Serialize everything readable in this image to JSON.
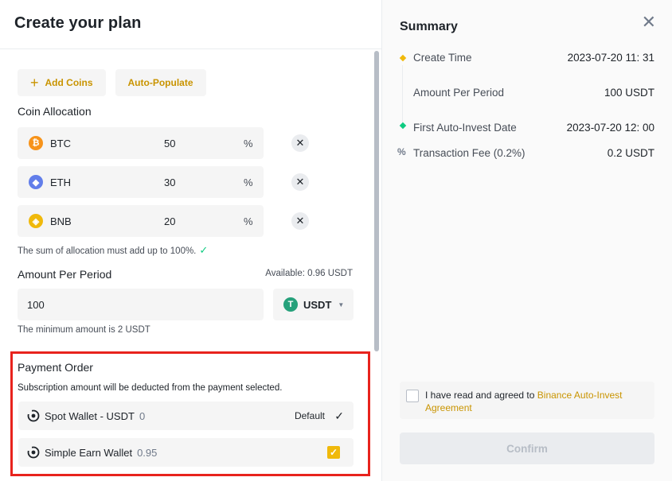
{
  "left": {
    "title": "Create your plan",
    "add_coins_label": "Add Coins",
    "auto_populate_label": "Auto-Populate",
    "coin_allocation_label": "Coin Allocation",
    "coins": [
      {
        "symbol": "BTC",
        "value": "50",
        "unit": "%",
        "icon_color": "#f7931a",
        "icon": "₿"
      },
      {
        "symbol": "ETH",
        "value": "30",
        "unit": "%",
        "icon_color": "#627eea",
        "icon": "◆"
      },
      {
        "symbol": "BNB",
        "value": "20",
        "unit": "%",
        "icon_color": "#f0b90b",
        "icon": "◈"
      }
    ],
    "allocation_hint": "The sum of allocation must add up to 100%.",
    "amount_label": "Amount Per Period",
    "available_text": "Available: 0.96 USDT",
    "amount_value": "100",
    "currency": "USDT",
    "minimum_hint": "The minimum amount is 2 USDT",
    "payment": {
      "title": "Payment Order",
      "subtitle": "Subscription amount will be deducted from the payment selected.",
      "options": [
        {
          "name": "Spot Wallet - USDT",
          "balance": "0",
          "tag": "Default"
        },
        {
          "name": "Simple Earn Wallet",
          "balance": "0.95",
          "tag": ""
        }
      ]
    }
  },
  "summary": {
    "title": "Summary",
    "rows": [
      {
        "label": "Create Time",
        "value": "2023-07-20 11: 31"
      },
      {
        "label": "Amount Per Period",
        "value": "100 USDT"
      },
      {
        "label": "First Auto-Invest Date",
        "value": "2023-07-20 12: 00"
      },
      {
        "label": "Transaction Fee (0.2%)",
        "value": "0.2 USDT"
      }
    ],
    "agree_text": "I have read and agreed to ",
    "agree_link": "Binance Auto-Invest Agreement",
    "confirm_label": "Confirm"
  },
  "colors": {
    "accent": "#c99400",
    "brand_yellow": "#f0b90b",
    "success": "#0ecb81",
    "highlight_border": "#e8231d"
  }
}
